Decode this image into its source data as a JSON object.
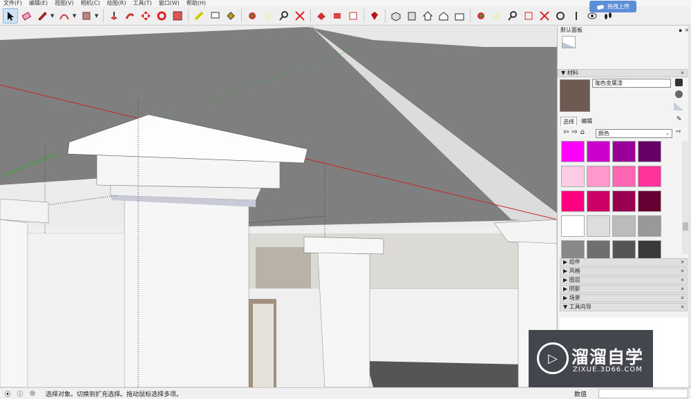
{
  "menubar": {
    "items": [
      "文件(F)",
      "编辑(E)",
      "视图(V)",
      "相机(C)",
      "绘图(R)",
      "工具(T)",
      "窗口(W)",
      "帮助(H)"
    ]
  },
  "upload_badge": {
    "label": "拖拽上传"
  },
  "panel": {
    "title": "默认面板",
    "materials": {
      "section_label": "材料",
      "material_name": "咖色金属漆",
      "current_color": "#6e5a51",
      "tabs": [
        "选择",
        "编辑"
      ],
      "library_select": "颜色",
      "swatches": [
        "#ff00ff",
        "#cc00cc",
        "#990099",
        "#660066",
        "#ffcce6",
        "#ff99cc",
        "#ff66b3",
        "#ff3399",
        "#ff0080",
        "#cc0066",
        "#99004d",
        "#660033",
        "#ffffff",
        "#dddddd",
        "#bbbbbb",
        "#999999",
        "#888888",
        "#6f6f6f",
        "#555555",
        "#3a3a3a"
      ]
    },
    "collapsed_sections": [
      "组件",
      "风格",
      "图层",
      "阴影",
      "场景"
    ],
    "instructor": {
      "label": "工具向导"
    }
  },
  "statusbar": {
    "message": "选择对象。切换到扩充选择。拖动鼠标选择多项。",
    "measurements_label": "数值"
  },
  "watermark": {
    "brand": "溜溜自学",
    "url": "ZIXUE.3D66.COM"
  },
  "icons": [
    "select-arrow",
    "eraser",
    "pencil",
    "arc",
    "rectangle",
    "push-pull",
    "follow-me",
    "move",
    "rotate",
    "scale",
    "tape-measure",
    "text",
    "paint-bucket",
    "orbit",
    "pan",
    "zoom",
    "zoom-extents",
    "warehouse",
    "extension",
    "layout",
    "ruby",
    "iso-view",
    "front-view",
    "home",
    "top-view",
    "side-view"
  ]
}
